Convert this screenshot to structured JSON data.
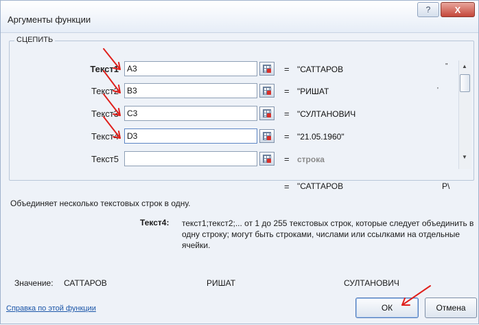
{
  "dialog": {
    "title": "Аргументы функции",
    "help_button": "?",
    "close_button": "X"
  },
  "function_name": "СЦЕПИТЬ",
  "arguments": [
    {
      "label": "Текст1",
      "value": "A3",
      "result": "\"САТТАРОВ",
      "marker": "\""
    },
    {
      "label": "Текст2",
      "value": "B3",
      "result": "\"РИШАТ",
      "marker": "'"
    },
    {
      "label": "Текст3",
      "value": "C3",
      "result": "\"СУЛТАНОВИЧ",
      "marker": ""
    },
    {
      "label": "Текст4",
      "value": "D3",
      "result": "\"21.05.1960\"",
      "marker": ""
    },
    {
      "label": "Текст5",
      "value": "",
      "result": "строка",
      "marker": ""
    }
  ],
  "equals_sign": "=",
  "result": {
    "value": "\"САТТАРОВ",
    "tail": "Р\\"
  },
  "description": "Объединяет несколько текстовых строк в одну.",
  "parameter": {
    "name": "Текст4:",
    "description": "текст1;текст2;... от 1 до 255 текстовых строк, которые следует объединить в одну строку; могут быть строками, числами или ссылками на отдельные ячейки."
  },
  "value_row": {
    "label": "Значение:",
    "part1": "САТТАРОВ",
    "part2": "РИШАТ",
    "part3": "СУЛТАНОВИЧ"
  },
  "help_link": "Справка по этой функции",
  "buttons": {
    "ok": "ОК",
    "cancel": "Отмена"
  },
  "colors": {
    "annotation_arrow": "#e0201c",
    "dialog_bg": "#eef2f8",
    "link": "#1a55a8"
  },
  "icons": {
    "ref_button": "range-select-icon",
    "scroll_up": "scroll-up-arrow-icon",
    "scroll_down": "scroll-down-arrow-icon"
  }
}
